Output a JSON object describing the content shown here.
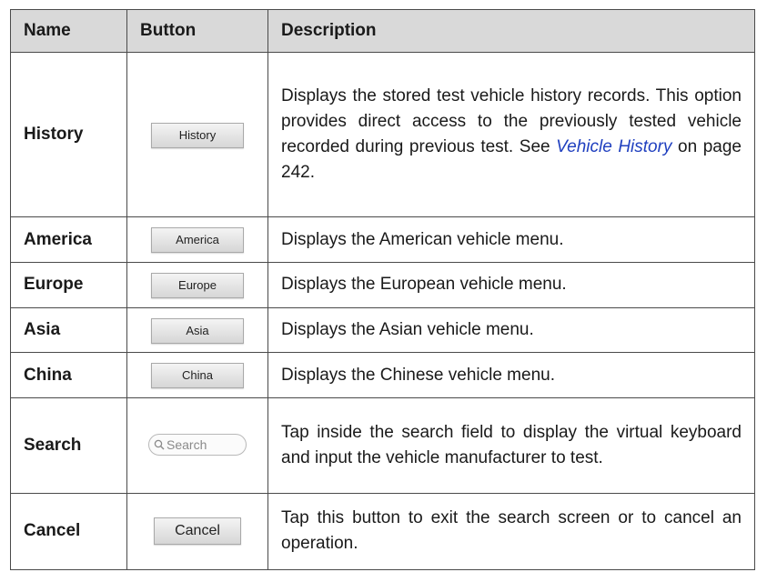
{
  "table": {
    "headers": [
      "Name",
      "Button",
      "Description"
    ],
    "rows": [
      {
        "name": "History",
        "button_label": "History",
        "desc_pre": "Displays the stored test vehicle history records. This option provides direct access to the previously tested vehicle recorded during previous test. See ",
        "desc_link": "Vehicle History",
        "desc_post": " on page 242."
      },
      {
        "name": "America",
        "button_label": "America",
        "desc": "Displays the American vehicle menu."
      },
      {
        "name": "Europe",
        "button_label": "Europe",
        "desc": "Displays the European vehicle menu."
      },
      {
        "name": "Asia",
        "button_label": "Asia",
        "desc": "Displays the Asian vehicle menu."
      },
      {
        "name": "China",
        "button_label": "China",
        "desc": "Displays the Chinese vehicle menu."
      },
      {
        "name": "Search",
        "button_label": "Search",
        "desc": "Tap inside the search field to display the virtual keyboard and input the vehicle manufacturer to test."
      },
      {
        "name": "Cancel",
        "button_label": "Cancel",
        "desc": "Tap this button to exit the search screen or to cancel an operation."
      }
    ]
  },
  "colors": {
    "header_bg": "#d9d9d9",
    "link": "#1f3fbf",
    "border": "#4a4a4a"
  },
  "icons": {
    "search_field": "magnifier-icon"
  }
}
